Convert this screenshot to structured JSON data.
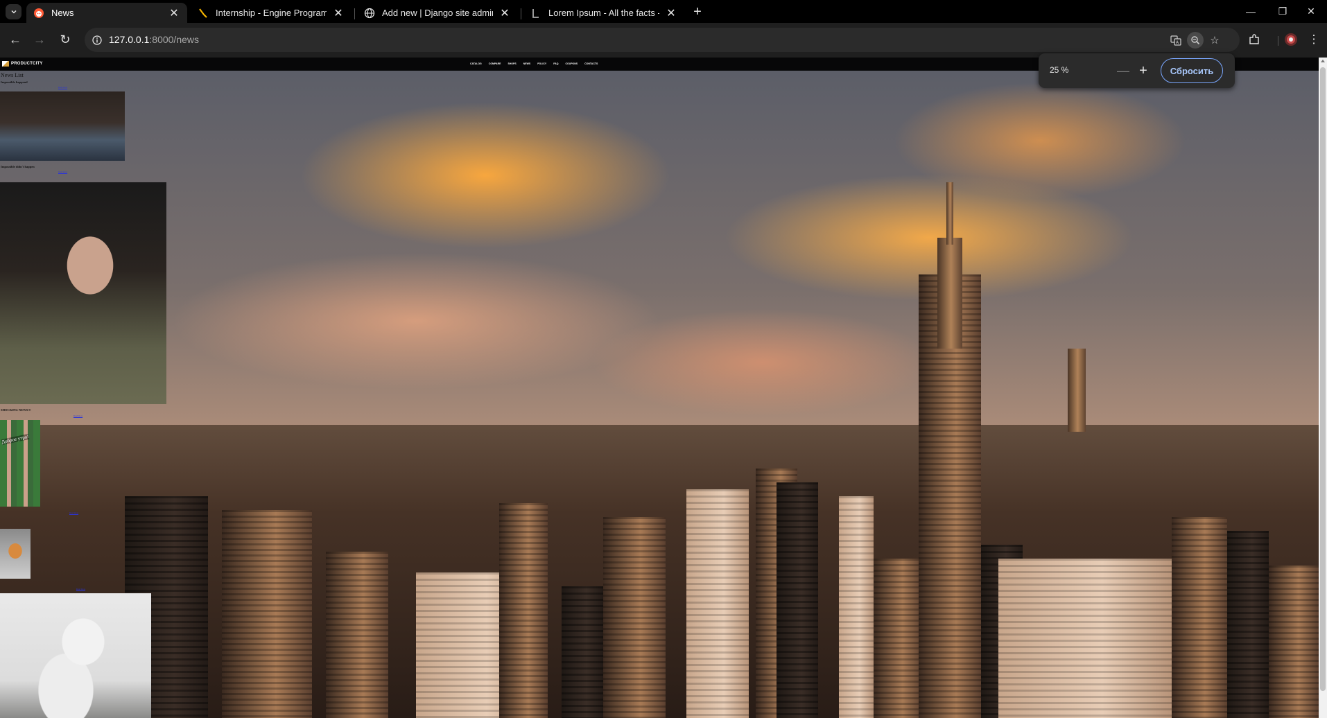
{
  "browser": {
    "tabs": [
      {
        "title": "News",
        "active": true,
        "icon": "reddit-like-icon"
      },
      {
        "title": "Internship - Engine Programme",
        "active": false,
        "icon": "yandex-icon"
      },
      {
        "title": "Add new | Django site admin",
        "active": false,
        "icon": "globe-icon"
      },
      {
        "title": "Lorem Ipsum - All the facts - Li",
        "active": false,
        "icon": "lipsum-icon"
      }
    ],
    "url_host": "127.0.0.1",
    "url_path": ":8000/news",
    "zoom": {
      "value": "25 %",
      "reset_label": "Сбросить"
    }
  },
  "site": {
    "logo_text": "PRODUCTCITY",
    "logo_sub": "",
    "menu": [
      "CATALOG",
      "COMPARE",
      "SHOPS",
      "NEWS",
      "POLICY",
      "FAQ",
      "COUPONS",
      "CONTACTS"
    ]
  },
  "news": {
    "heading": "News List",
    "items": [
      {
        "title": "Impossible happend",
        "text": "",
        "link": "Read more"
      },
      {
        "title": "Impossible didn't happen",
        "text": "",
        "link": "Read more"
      },
      {
        "title": "SHOCKING NEWS!!!",
        "text": "",
        "link": "Read more"
      },
      {
        "title": "",
        "text": "",
        "link": "Read more"
      },
      {
        "title": "",
        "text": "",
        "link": "Read more"
      }
    ],
    "doll_caption": "Доброе утро!"
  },
  "colors": {
    "accent": "#a8c7fa",
    "tab_active": "#1f1f1f",
    "toolbar": "#1f1f1f"
  }
}
